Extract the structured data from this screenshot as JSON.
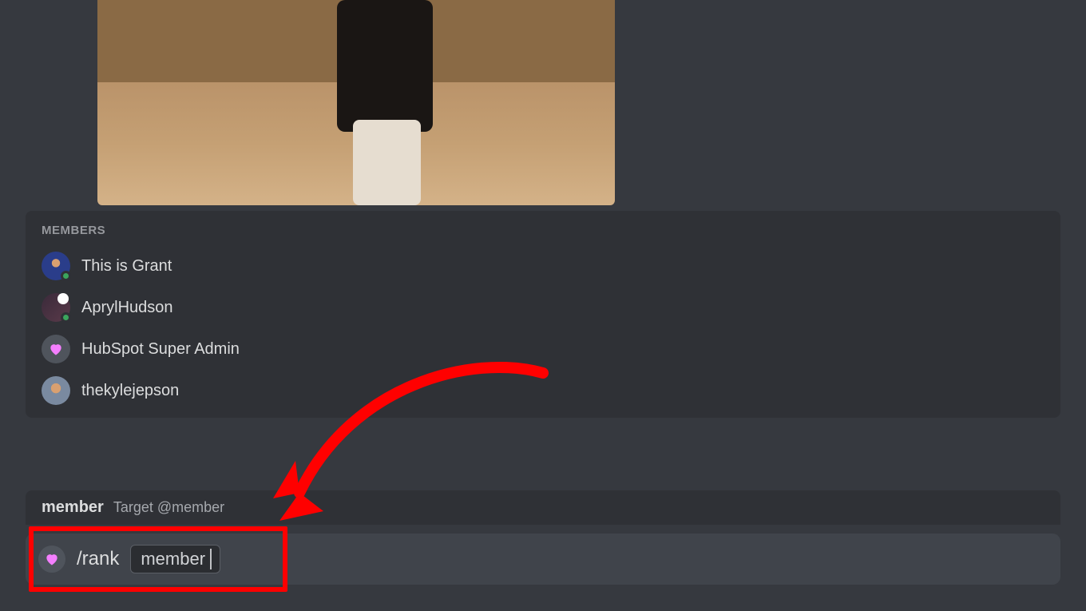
{
  "autocomplete": {
    "header": "MEMBERS",
    "members": [
      {
        "name": "This is Grant",
        "has_status": true
      },
      {
        "name": "AprylHudson",
        "has_status": true
      },
      {
        "name": "HubSpot Super Admin",
        "has_status": false
      },
      {
        "name": "thekylejepson",
        "has_status": false
      }
    ]
  },
  "hint": {
    "param_name": "member",
    "description": "Target @member"
  },
  "input": {
    "command": "/rank",
    "param_value": "member"
  },
  "annotation": {
    "arrow_color": "#ff0000"
  }
}
